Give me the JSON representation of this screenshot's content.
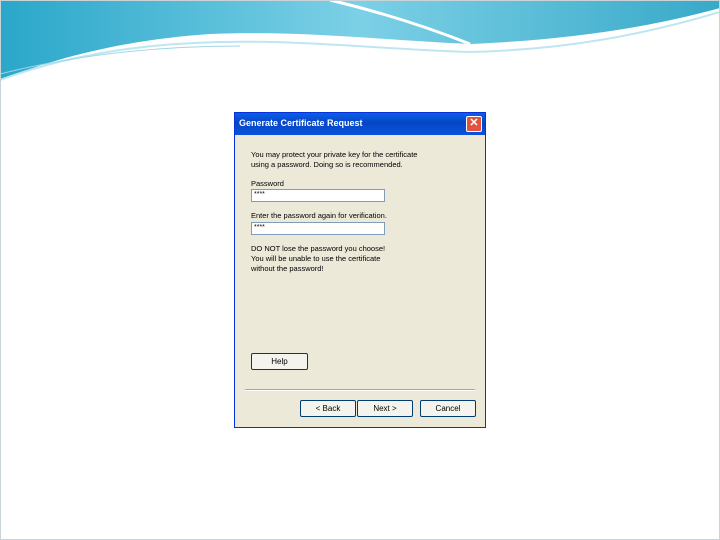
{
  "dialog": {
    "title": "Generate Certificate Request",
    "close_glyph": "✕",
    "intro_line1": "You may protect your private key for the certificate",
    "intro_line2": "using a password. Doing so is recommended.",
    "password_label": "Password",
    "password_value": "****",
    "confirm_label": "Enter the password again for verification.",
    "confirm_value": "****",
    "warning_line1": "DO NOT lose the password you choose!",
    "warning_line2": "You will be unable to use the certificate",
    "warning_line3": "without the password!",
    "help_label": "Help",
    "back_label": "< Back",
    "next_label": "Next >",
    "cancel_label": "Cancel"
  }
}
